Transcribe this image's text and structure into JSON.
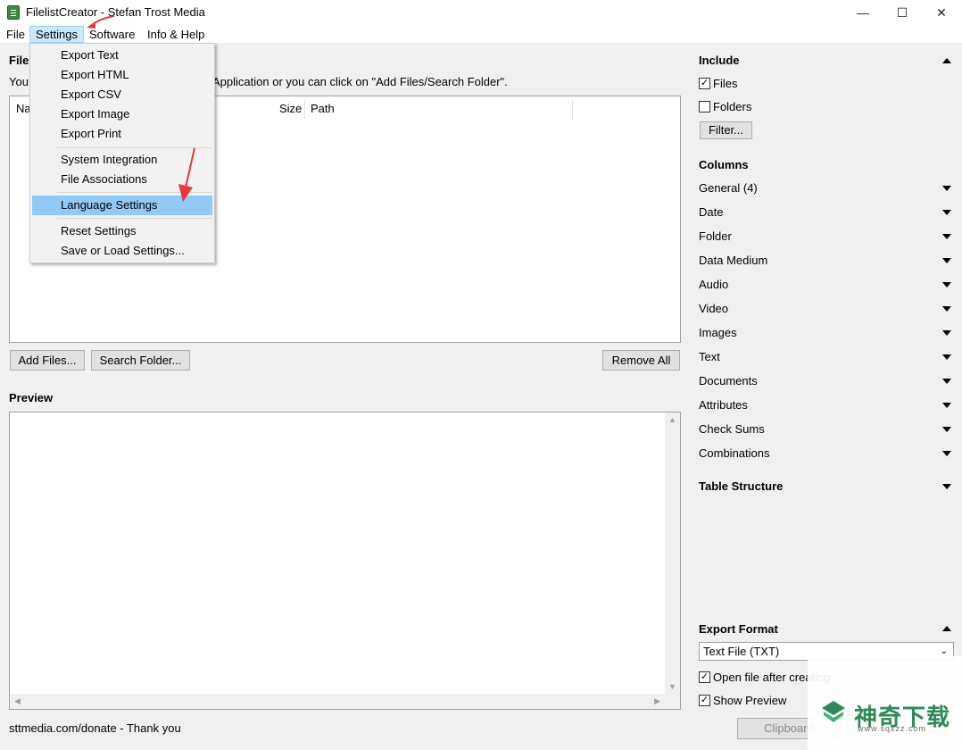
{
  "window": {
    "title": "FilelistCreator - Stefan Trost Media",
    "minimize": "—",
    "maximize": "☐",
    "close": "✕"
  },
  "menubar": [
    "File",
    "Settings",
    "Software",
    "Info & Help"
  ],
  "settings_menu": {
    "group1": [
      "Export Text",
      "Export HTML",
      "Export CSV",
      "Export Image",
      "Export Print"
    ],
    "group2": [
      "System Integration",
      "File Associations"
    ],
    "group3": [
      "Language Settings"
    ],
    "group4": [
      "Reset Settings",
      "Save or Load Settings..."
    ],
    "highlighted": "Language Settings"
  },
  "files": {
    "title": "File",
    "hint_prefix": "You",
    "hint": "Application or you can click on \"Add Files/Search Folder\".",
    "columns": {
      "name": "Na",
      "size": "Size",
      "path": "Path"
    }
  },
  "buttons": {
    "add_files": "Add Files...",
    "search_folder": "Search Folder...",
    "remove_all": "Remove All",
    "filter": "Filter...",
    "clipboard": "Clipboard"
  },
  "preview": {
    "title": "Preview"
  },
  "include": {
    "title": "Include",
    "files": {
      "label": "Files",
      "checked": true
    },
    "folders": {
      "label": "Folders",
      "checked": false
    }
  },
  "columns_panel": {
    "title": "Columns",
    "items": [
      "General (4)",
      "Date",
      "Folder",
      "Data Medium",
      "Audio",
      "Video",
      "Images",
      "Text",
      "Documents",
      "Attributes",
      "Check Sums",
      "Combinations"
    ]
  },
  "table_structure": {
    "title": "Table Structure"
  },
  "export_format": {
    "title": "Export Format",
    "selected": "Text File (TXT)",
    "open_after": {
      "label": "Open file after creating",
      "checked": true
    },
    "show_preview": {
      "label": "Show Preview",
      "checked": true
    }
  },
  "status": "sttmedia.com/donate - Thank you",
  "watermark": {
    "brand": "神奇下载",
    "url": "www.sqxzz.com"
  },
  "colors": {
    "menu_highlight": "#91c9f7",
    "menu_active": "#cce8ff",
    "annotation_arrow": "#e53935"
  }
}
